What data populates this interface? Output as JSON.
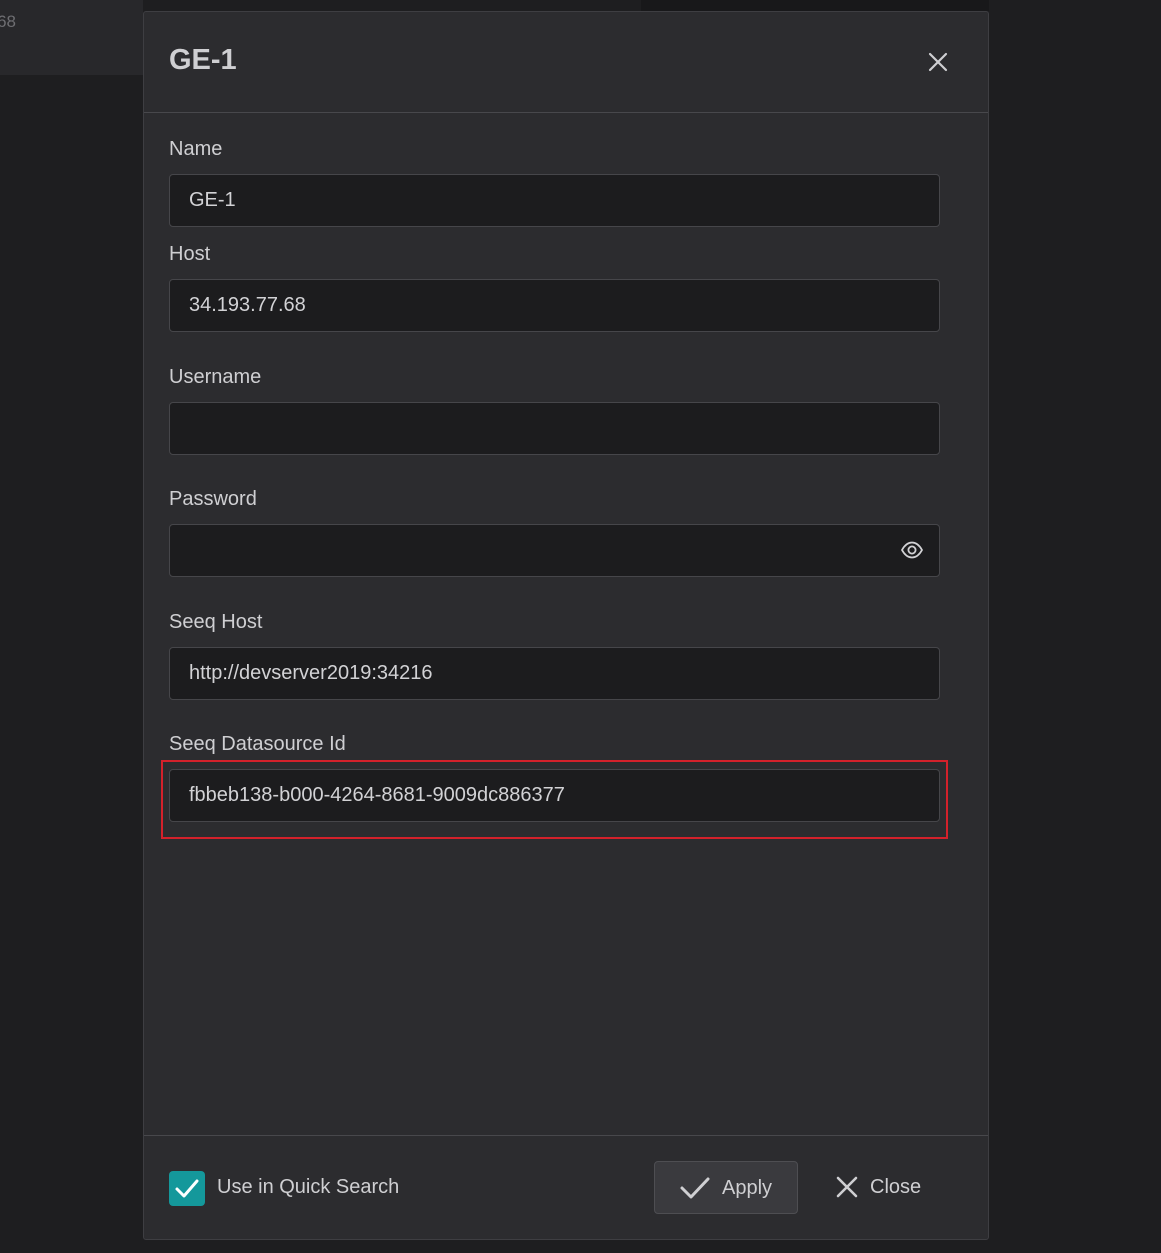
{
  "background": {
    "panel_text": "68"
  },
  "dialog": {
    "title": "GE-1",
    "close_icon": "close-icon"
  },
  "fields": {
    "name": {
      "label": "Name",
      "value": "GE-1"
    },
    "host": {
      "label": "Host",
      "value": "34.193.77.68"
    },
    "username": {
      "label": "Username",
      "value": ""
    },
    "password": {
      "label": "Password",
      "value": "",
      "icon": "eye-icon"
    },
    "seeq_host": {
      "label": "Seeq Host",
      "value": "http://devserver2019:34216"
    },
    "seeq_datasource_id": {
      "label": "Seeq Datasource Id",
      "value": "fbbeb138-b000-4264-8681-9009dc886377"
    }
  },
  "footer": {
    "quick_search_label": "Use in Quick Search",
    "quick_search_checked": true,
    "apply_label": "Apply",
    "close_label": "Close"
  },
  "colors": {
    "accent": "#14989b",
    "highlight": "#d4212b",
    "dialog_bg": "#2c2c2f",
    "input_bg": "#1c1c1e"
  }
}
